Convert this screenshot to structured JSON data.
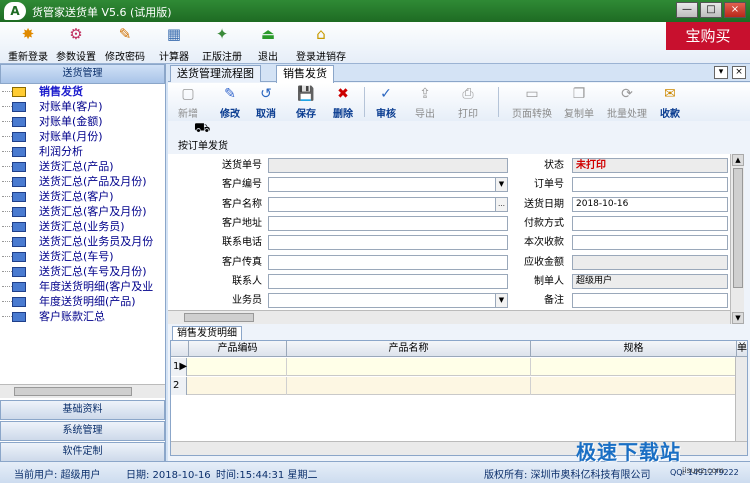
{
  "window": {
    "title": "货管家送货单 V5.6 (试用版)",
    "logo_text": "A",
    "min_label": "—",
    "max_label": "□",
    "close_label": "×"
  },
  "toolbar": {
    "items": [
      {
        "label": "重新登录",
        "icon": "relogin-icon",
        "glyph": "✸"
      },
      {
        "label": "参数设置",
        "icon": "settings-icon",
        "glyph": "⚙"
      },
      {
        "label": "修改密码",
        "icon": "password-icon",
        "glyph": "✎"
      },
      {
        "label": "计算器",
        "icon": "calculator-icon",
        "glyph": "▦"
      },
      {
        "label": "正版注册",
        "icon": "register-icon",
        "glyph": "✦"
      },
      {
        "label": "退出",
        "icon": "exit-icon",
        "glyph": "⏏"
      },
      {
        "label": "登录进销存",
        "icon": "login-erp-icon",
        "glyph": "⌂"
      }
    ],
    "promo": "宝购买"
  },
  "left": {
    "header": "送货管理",
    "tree": [
      "销售发货",
      "对账单(客户)",
      "对账单(金额)",
      "对账单(月份)",
      "利润分析",
      "送货汇总(产品)",
      "送货汇总(产品及月份)",
      "送货汇总(客户)",
      "送货汇总(客户及月份)",
      "送货汇总(业务员)",
      "送货汇总(业务员及月份",
      "送货汇总(车号)",
      "送货汇总(车号及月份)",
      "年度送货明细(客户及业",
      "年度送货明细(产品)",
      "客户账款汇总"
    ],
    "sections": [
      "基础资料",
      "系统管理",
      "软件定制"
    ]
  },
  "tabs": [
    "送货管理流程图",
    "销售发货"
  ],
  "tab_controls": {
    "dropdown": "▾",
    "close": "×"
  },
  "main_toolbar": [
    {
      "label": "新增",
      "glyph": "▢",
      "icon": "new-doc-icon",
      "disabled": true
    },
    {
      "label": "修改",
      "glyph": "✎",
      "icon": "edit-icon",
      "disabled": false
    },
    {
      "label": "取消",
      "glyph": "↺",
      "icon": "cancel-icon",
      "disabled": false
    },
    {
      "label": "保存",
      "glyph": "💾",
      "icon": "save-icon",
      "disabled": false
    },
    {
      "label": "删除",
      "glyph": "✖",
      "icon": "delete-icon",
      "disabled": false
    },
    {
      "label": "审核",
      "glyph": "✓",
      "icon": "audit-icon",
      "disabled": false
    },
    {
      "label": "导出",
      "glyph": "⇪",
      "icon": "export-icon",
      "disabled": true
    },
    {
      "label": "打印",
      "glyph": "⎙",
      "icon": "print-icon",
      "disabled": true
    },
    {
      "label": "页面转换",
      "glyph": "▭",
      "icon": "page-switch-icon",
      "disabled": true
    },
    {
      "label": "复制单",
      "glyph": "❐",
      "icon": "copy-icon",
      "disabled": true
    },
    {
      "label": "批量处理",
      "glyph": "⟳",
      "icon": "batch-icon",
      "disabled": true
    },
    {
      "label": "收款",
      "glyph": "✉",
      "icon": "receive-payment-icon",
      "disabled": false
    }
  ],
  "sub_toolbar": {
    "label": "按订单发货"
  },
  "form": {
    "left": [
      {
        "label": "送货单号",
        "value": "",
        "gray": true,
        "dropdown": false
      },
      {
        "label": "客户编号",
        "value": "",
        "gray": false,
        "dropdown": true
      },
      {
        "label": "客户名称",
        "value": "",
        "gray": false,
        "dropdown": false,
        "ellipsis": true
      },
      {
        "label": "客户地址",
        "value": "",
        "gray": false,
        "dropdown": false
      },
      {
        "label": "联系电话",
        "value": "",
        "gray": false,
        "dropdown": false
      },
      {
        "label": "客户传真",
        "value": "",
        "gray": false,
        "dropdown": false
      },
      {
        "label": "联系人",
        "value": "",
        "gray": false,
        "dropdown": false
      },
      {
        "label": "业务员",
        "value": "",
        "gray": false,
        "dropdown": true
      }
    ],
    "right": [
      {
        "label": "状态",
        "value": "未打印",
        "style": "red"
      },
      {
        "label": "订单号",
        "value": "",
        "style": "normal"
      },
      {
        "label": "送货日期",
        "value": "2018-10-16",
        "style": "normal"
      },
      {
        "label": "付款方式",
        "value": "",
        "style": "normal"
      },
      {
        "label": "本次收款",
        "value": "",
        "style": "normal"
      },
      {
        "label": "应收金额",
        "value": "",
        "style": "gray"
      },
      {
        "label": "制单人",
        "value": "超级用户",
        "style": "gray"
      },
      {
        "label": "备注",
        "value": "",
        "style": "normal"
      }
    ]
  },
  "detail": {
    "tab": "销售发货明细",
    "columns": [
      "产品编码",
      "产品名称",
      "规格",
      "单"
    ],
    "rows": [
      "1",
      "2"
    ],
    "current_row_marker": "▶"
  },
  "status": {
    "user": "当前用户: 超级用户",
    "date": "日期: 2018-10-16",
    "time": "时间:15:44:31 星期二",
    "copyright": "版权所有: 深圳市奥科亿科技有限公司",
    "qq": "QQ: 1491279222"
  },
  "watermark": {
    "text": "极速下载站",
    "url": "jisuxz.com"
  }
}
